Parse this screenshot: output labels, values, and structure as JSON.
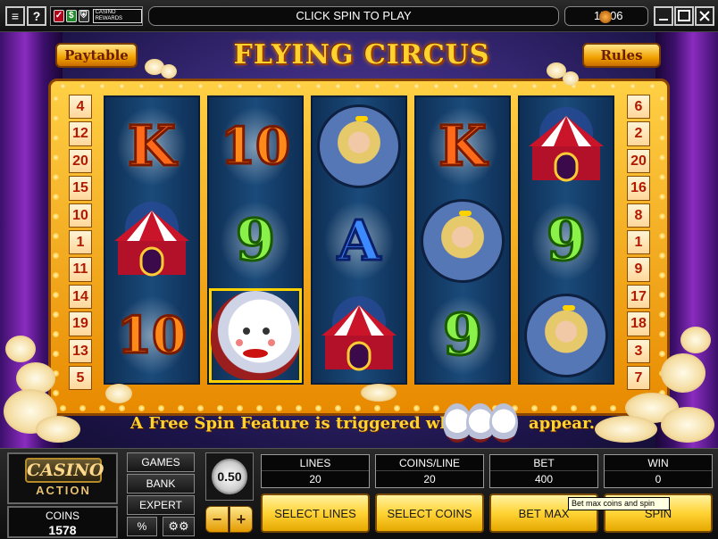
{
  "topbar": {
    "help_label": "?",
    "rewards_label": "CASINO REWARDS",
    "message": "CLICK SPIN TO PLAY",
    "clock": "15:06"
  },
  "game": {
    "title": "FLYING CIRCUS",
    "paytable_label": "Paytable",
    "rules_label": "Rules",
    "paylines_left": [
      "4",
      "12",
      "20",
      "15",
      "10",
      "1",
      "11",
      "14",
      "19",
      "13",
      "5"
    ],
    "paylines_right": [
      "6",
      "2",
      "20",
      "16",
      "8",
      "1",
      "9",
      "17",
      "18",
      "3",
      "7"
    ],
    "reels": [
      [
        "K",
        "tent",
        "10"
      ],
      [
        "10",
        "9",
        "clown"
      ],
      [
        "woman",
        "A",
        "tent"
      ],
      [
        "K",
        "woman",
        "9"
      ],
      [
        "tent",
        "9",
        "woman"
      ]
    ],
    "free_spin_text_before": "A Free Spin Feature is triggered when",
    "free_spin_text_after": "appear."
  },
  "console": {
    "logo_top": "CASINO",
    "logo_bottom": "ACTION",
    "coins_label": "COINS",
    "coins_value": "1578",
    "games_label": "GAMES",
    "bank_label": "BANK",
    "expert_label": "EXPERT",
    "percent_label": "%",
    "coin_size": "0.50",
    "lines_label": "LINES",
    "lines_value": "20",
    "coins_per_line_label": "COINS/LINE",
    "coins_per_line_value": "20",
    "bet_label": "BET",
    "bet_value": "400",
    "win_label": "WIN",
    "win_value": "0",
    "select_lines_label": "SELECT LINES",
    "select_coins_label": "SELECT COINS",
    "bet_max_label": "BET MAX",
    "spin_label": "SPIN",
    "tooltip": "Bet max coins and spin"
  },
  "colors": {
    "accent_gold": "#ffd22e",
    "reel_blue": "#1a4a7a",
    "frame_orange": "#f0a000"
  }
}
